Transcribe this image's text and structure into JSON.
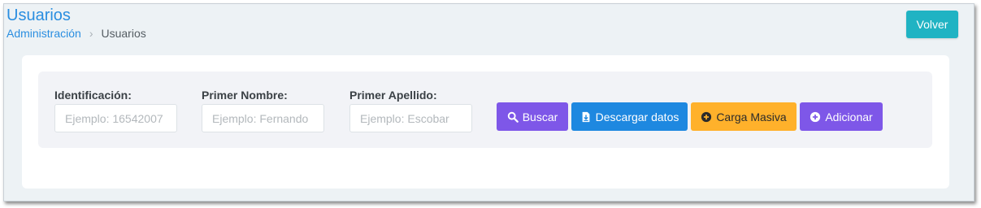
{
  "header": {
    "title": "Usuarios",
    "breadcrumb": {
      "parent": "Administración",
      "separator": "›",
      "current": "Usuarios"
    },
    "back_label": "Volver"
  },
  "filters": {
    "identification": {
      "label": "Identificación:",
      "placeholder": "Ejemplo: 16542007",
      "value": ""
    },
    "first_name": {
      "label": "Primer Nombre:",
      "placeholder": "Ejemplo: Fernando",
      "value": ""
    },
    "first_surname": {
      "label": "Primer Apellido:",
      "placeholder": "Ejemplo: Escobar",
      "value": ""
    }
  },
  "actions": {
    "search": {
      "label": "Buscar",
      "icon": "search-icon",
      "color": "#7e57e8"
    },
    "download": {
      "label": "Descargar datos",
      "icon": "file-download-icon",
      "color": "#1e88e0"
    },
    "bulk_upload": {
      "label": "Carga Masiva",
      "icon": "plus-circle-icon",
      "color": "#ffb12b"
    },
    "add": {
      "label": "Adicionar",
      "icon": "plus-circle-icon",
      "color": "#7e57e8"
    }
  },
  "colors": {
    "accent": "#2a8ee0",
    "back_button": "#20b3c3",
    "background": "#edf2f5"
  }
}
